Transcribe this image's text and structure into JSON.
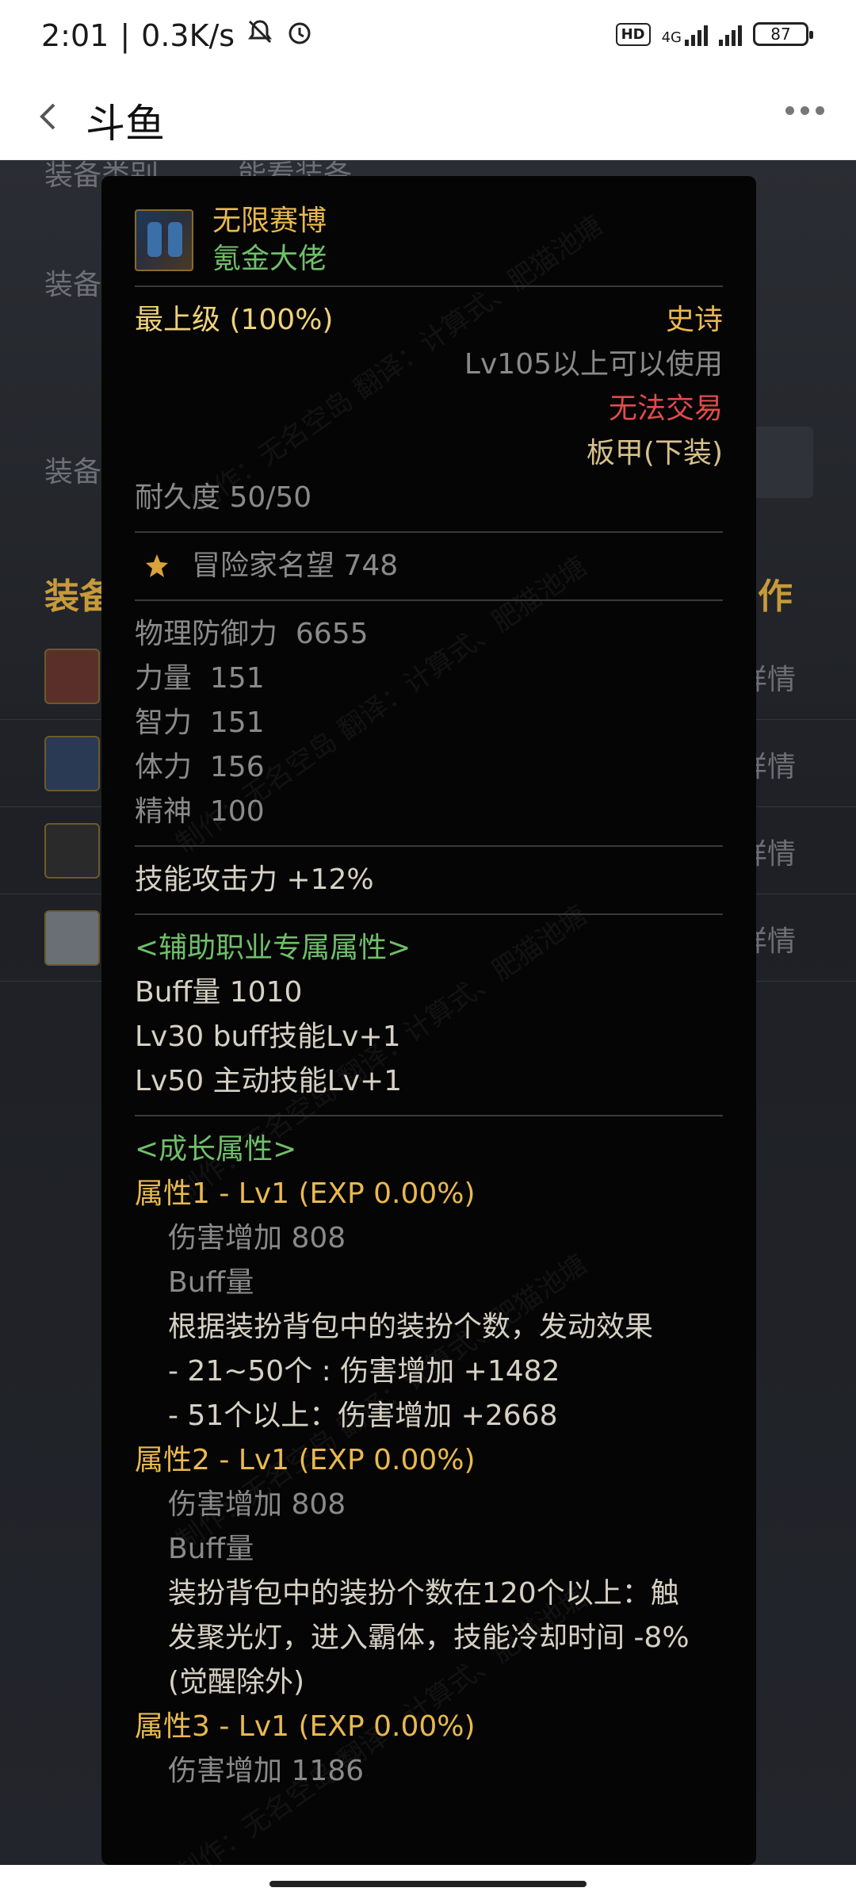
{
  "status_bar": {
    "time": "2:01",
    "net_speed": "0.3K/s",
    "hd_badge": "HD",
    "net_type": "4G",
    "battery": "87"
  },
  "app_bar": {
    "title": "斗鱼"
  },
  "background": {
    "labels": [
      "装备类别",
      "装备",
      "装备"
    ],
    "filter_value": "能看装备",
    "section_head_left": "装备",
    "section_head_right": "作",
    "detail_label": "详情"
  },
  "tooltip": {
    "item_name": "无限赛博",
    "item_subtitle": "氪金大佬",
    "grade": "最上级 (100%)",
    "rarity": "史诗",
    "level_req": "Lv105以上可以使用",
    "trade": "无法交易",
    "type": "板甲(下装)",
    "durability": "耐久度 50/50",
    "reputation": "冒险家名望 748",
    "stats": [
      {
        "label": "物理防御力",
        "value": "6655"
      },
      {
        "label": "力量",
        "value": "151"
      },
      {
        "label": "智力",
        "value": "151"
      },
      {
        "label": "体力",
        "value": "156"
      },
      {
        "label": "精神",
        "value": "100"
      }
    ],
    "skill_attack": "技能攻击力  +12%",
    "support_header": "<辅助职业专属属性>",
    "support_lines": [
      "Buff量   1010",
      "Lv30 buff技能Lv+1",
      "Lv50 主动技能Lv+1"
    ],
    "growth_header": "<成长属性>",
    "attr1_title": "属性1 - Lv1 (EXP 0.00%)",
    "attr1_damage": "伤害增加  808",
    "attr1_buff": "Buff量",
    "attr1_lines": [
      "根据装扮背包中的装扮个数，发动效果",
      "- 21~50个 : 伤害增加 +1482",
      "- 51个以上：伤害增加 +2668"
    ],
    "attr2_title": "属性2 - Lv1 (EXP 0.00%)",
    "attr2_damage": "伤害增加  808",
    "attr2_buff": "Buff量",
    "attr2_lines": [
      "装扮背包中的装扮个数在120个以上：触",
      "发聚光灯，进入霸体，技能冷却时间 -8%",
      "(觉醒除外)"
    ],
    "attr3_title": "属性3 - Lv1 (EXP 0.00%)",
    "attr3_partial": "伤害增加  1186"
  },
  "watermark_text": "制作：无名空岛  翻译：计算式、肥猫池塘"
}
